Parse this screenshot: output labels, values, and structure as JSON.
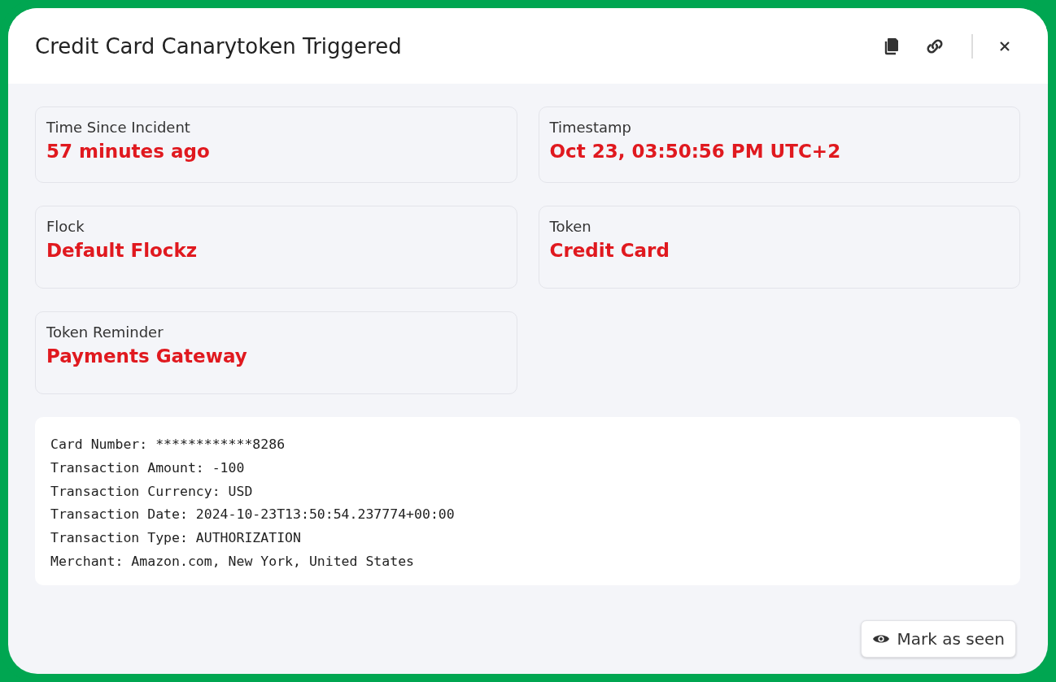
{
  "dialog": {
    "title": "Credit Card Canarytoken Triggered"
  },
  "fields": [
    {
      "label": "Time Since Incident",
      "value": "57 minutes ago"
    },
    {
      "label": "Timestamp",
      "value": "Oct 23, 03:50:56 PM UTC+2"
    },
    {
      "label": "Flock",
      "value": "Default Flockz"
    },
    {
      "label": "Token",
      "value": "Credit Card"
    },
    {
      "label": "Token Reminder",
      "value": "Payments Gateway"
    }
  ],
  "details": [
    "Card Number: ************8286",
    "Transaction Amount: -100",
    "Transaction Currency: USD",
    "Transaction Date: 2024-10-23T13:50:54.237774+00:00",
    "Transaction Type: AUTHORIZATION",
    "Merchant: Amazon.com, New York, United States"
  ],
  "footer": {
    "button": "Mark as seen"
  }
}
